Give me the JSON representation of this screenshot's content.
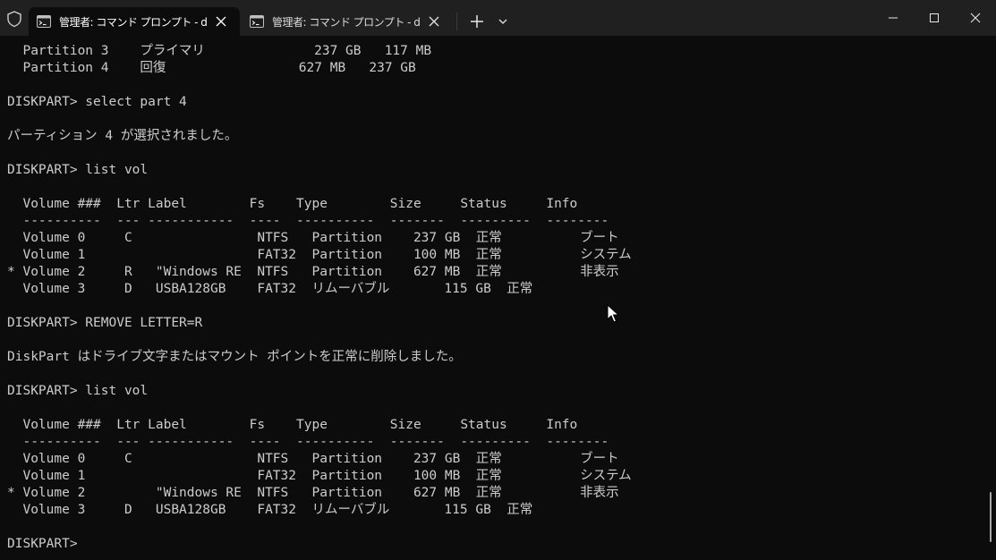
{
  "colors": {
    "terminal_background": "#0c0c0c",
    "titlebar_background": "#202020",
    "text": "#cccccc"
  },
  "tabs": [
    {
      "title": "管理者: コマンド プロンプト - diskpart",
      "icon": "command-prompt-icon",
      "active": true
    },
    {
      "title": "管理者: コマンド プロンプト - diskpart",
      "icon": "command-prompt-icon",
      "active": false
    }
  ],
  "window_controls": [
    "minimize-icon",
    "maximize-icon",
    "close-icon"
  ],
  "console_lines": [
    "  Partition 3    プライマリ              237 GB   117 MB",
    "  Partition 4    回復                 627 MB   237 GB",
    "",
    "DISKPART> select part 4",
    "",
    "パーティション 4 が選択されました。",
    "",
    "DISKPART> list vol",
    "",
    "  Volume ###  Ltr Label        Fs    Type        Size     Status     Info",
    "  ----------  --- -----------  ----  ----------  -------  ---------  --------",
    "  Volume 0     C                NTFS   Partition    237 GB  正常          ブート",
    "  Volume 1                      FAT32  Partition    100 MB  正常          システム",
    "* Volume 2     R   \"Windows RE  NTFS   Partition    627 MB  正常          非表示",
    "  Volume 3     D   USBA128GB    FAT32  リムーバブル       115 GB  正常",
    "",
    "DISKPART> REMOVE LETTER=R",
    "",
    "DiskPart はドライブ文字またはマウント ポイントを正常に削除しました。",
    "",
    "DISKPART> list vol",
    "",
    "  Volume ###  Ltr Label        Fs    Type        Size     Status     Info",
    "  ----------  --- -----------  ----  ----------  -------  ---------  --------",
    "  Volume 0     C                NTFS   Partition    237 GB  正常          ブート",
    "  Volume 1                      FAT32  Partition    100 MB  正常          システム",
    "* Volume 2         \"Windows RE  NTFS   Partition    627 MB  正常          非表示",
    "  Volume 3     D   USBA128GB    FAT32  リムーバブル       115 GB  正常",
    "",
    "DISKPART> "
  ]
}
